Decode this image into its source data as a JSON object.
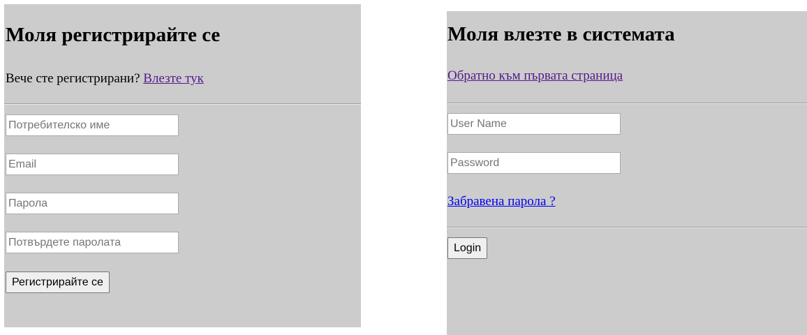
{
  "register": {
    "title": "Моля регистрирайте се",
    "already_registered_text": "Вече сте регистрирани?",
    "login_link": "Влезте тук",
    "username_placeholder": "Потребителско име",
    "email_placeholder": "Email",
    "password_placeholder": "Парола",
    "confirm_password_placeholder": "Потвърдете паролата",
    "submit_label": "Регистрирайте се"
  },
  "login": {
    "title": "Моля влезте в системата",
    "back_link": "Обратно към първата страница",
    "username_placeholder": "User Name",
    "password_placeholder": "Password",
    "forgot_password_link": "Забравена парола ?",
    "submit_label": "Login"
  },
  "colors": {
    "panel_background": "#cccccc",
    "visited_link": "#551a8b",
    "unvisited_link": "#0000ee"
  }
}
